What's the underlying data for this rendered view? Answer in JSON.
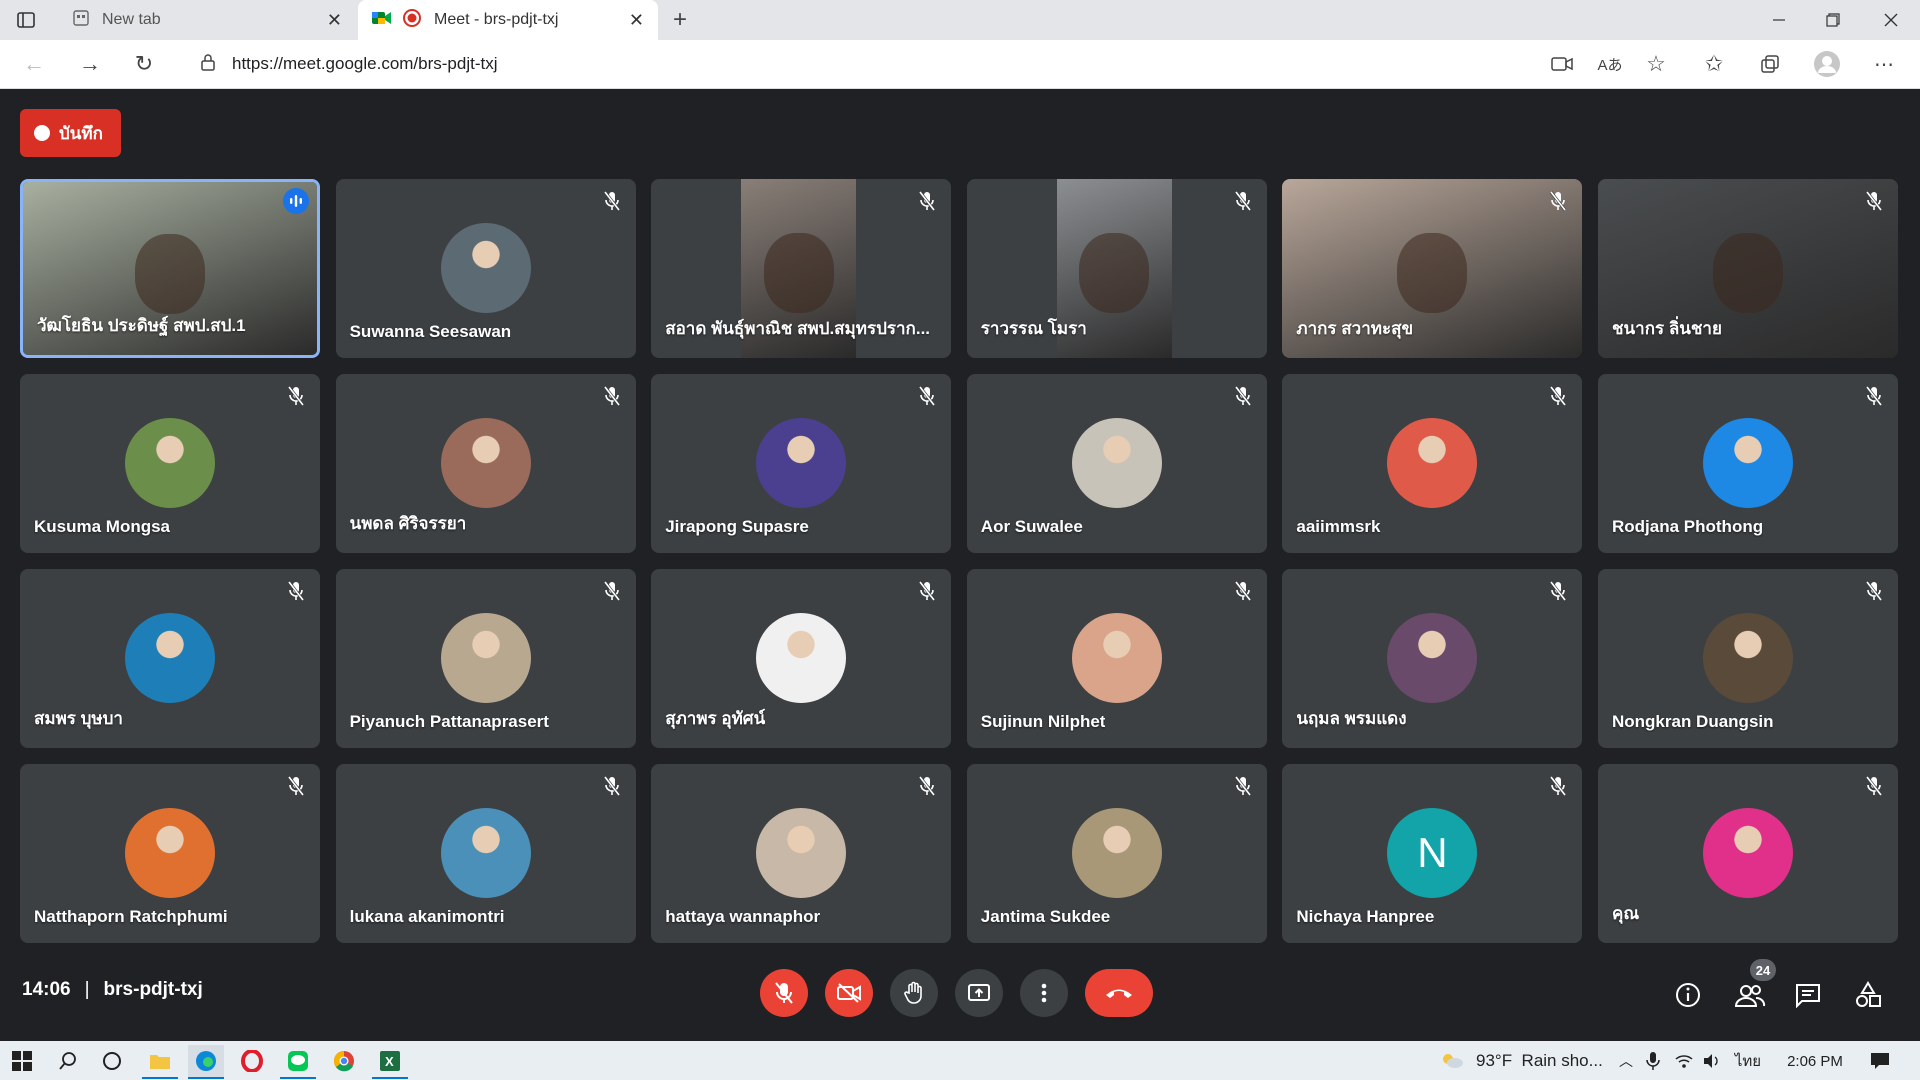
{
  "browser": {
    "tabs": [
      {
        "label": "New tab",
        "active": false
      },
      {
        "label": "Meet - brs-pdjt-txj",
        "active": true
      }
    ],
    "url": "https://meet.google.com/brs-pdjt-txj"
  },
  "meeting": {
    "record_label": "บันทึก",
    "time": "14:06",
    "code": "brs-pdjt-txj",
    "participant_count": "24",
    "participants": [
      {
        "name": "วัฒโยธิน ประดิษฐ์ สพป.สป.1",
        "kind": "video",
        "speaking": true,
        "color": "#a8b0a0"
      },
      {
        "name": "Suwanna Seesawan",
        "kind": "avatar",
        "color": "#5c6b73"
      },
      {
        "name": "สอาด พันธุ์พาณิช สพป.สมุทรปราก...",
        "kind": "video",
        "color": "#8a7f78"
      },
      {
        "name": "ราวรรณ โมรา",
        "kind": "video",
        "color": "#8c8f92"
      },
      {
        "name": "ภากร สวาทะสุข",
        "kind": "video",
        "color": "#b9a79a"
      },
      {
        "name": "ชนากร ลิ่นชาย",
        "kind": "video",
        "color": "#4a4d4f"
      },
      {
        "name": "Kusuma Mongsa",
        "kind": "avatar",
        "color": "#6b8f4a"
      },
      {
        "name": "นพดล ศิริจรรยา",
        "kind": "avatar",
        "color": "#9a6b5a"
      },
      {
        "name": "Jirapong Supasre",
        "kind": "avatar",
        "color": "#4b3f8f"
      },
      {
        "name": "Aor Suwalee",
        "kind": "avatar",
        "color": "#c8c3b8"
      },
      {
        "name": "aaiimmsrk",
        "kind": "avatar",
        "color": "#e05a4a"
      },
      {
        "name": "Rodjana Phothong",
        "kind": "avatar",
        "color": "#1e88e5"
      },
      {
        "name": "สมพร บุษบา",
        "kind": "avatar",
        "color": "#1e7fb8"
      },
      {
        "name": "Piyanuch Pattanaprasert",
        "kind": "avatar",
        "color": "#b8a890"
      },
      {
        "name": "สุภาพร อุทัศน์",
        "kind": "avatar",
        "color": "#f0f0f0"
      },
      {
        "name": "Sujinun Nilphet",
        "kind": "avatar",
        "color": "#d9a48a"
      },
      {
        "name": "นฤมล พรมแดง",
        "kind": "avatar",
        "color": "#6a4a6a"
      },
      {
        "name": "Nongkran Duangsin",
        "kind": "avatar",
        "color": "#5a4a3a"
      },
      {
        "name": "Natthaporn Ratchphumi",
        "kind": "avatar",
        "color": "#e07030"
      },
      {
        "name": "lukana akanimontri",
        "kind": "avatar",
        "color": "#4a90b8"
      },
      {
        "name": "hattaya wannaphor",
        "kind": "avatar",
        "color": "#c8b8a8"
      },
      {
        "name": "Jantima Sukdee",
        "kind": "avatar",
        "color": "#a89878"
      },
      {
        "name": "Nichaya Hanpree",
        "kind": "initial",
        "initial": "N",
        "color": "#12a4a8"
      },
      {
        "name": "คุณ",
        "kind": "avatar",
        "color": "#e0308a"
      }
    ]
  },
  "taskbar": {
    "weather": "93°F  Rain sho...",
    "language": "ไทย",
    "clock": "2:06 PM"
  }
}
